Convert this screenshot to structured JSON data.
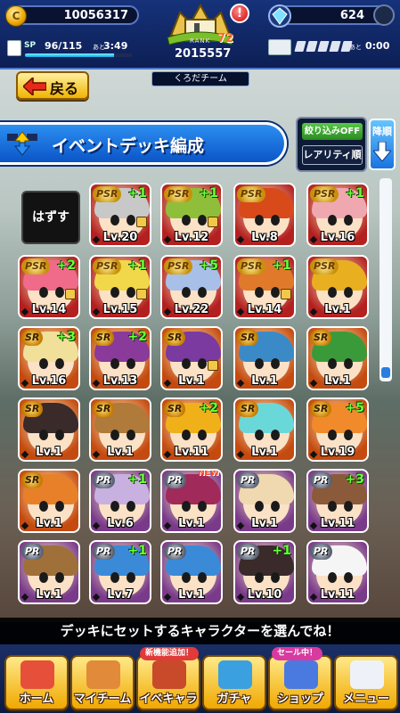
{
  "status": {
    "coins": "10056317",
    "gems": "624",
    "rank_label": "RANK",
    "rank": "72",
    "rank_score": "2015557",
    "team_name": "くろだチーム",
    "sp_label": "SP",
    "sp_value": "96/115",
    "sp_remaining_label": "あと",
    "sp_timer": "3:49",
    "sp_fraction": 0.835,
    "ticket_remaining_label": "あと",
    "ticket_timer": "0:00",
    "alert": "!"
  },
  "header": {
    "back_label": "戻る",
    "title": "イベントデッキ編成",
    "filter_label": "絞り込みOFF",
    "rarity_sort_label": "レアリティ順",
    "sort_order_label": "降順"
  },
  "grid": {
    "remove_label": "はずす",
    "cards": [
      {
        "rarity": "PSR",
        "plus": "+1",
        "level": "Lv.20",
        "locked": true,
        "hair": "#c8c8c8",
        "bg": "#b32020"
      },
      {
        "rarity": "PSR",
        "plus": "+1",
        "level": "Lv.12",
        "locked": true,
        "hair": "#8fbf3a",
        "bg": "#b32020"
      },
      {
        "rarity": "PSR",
        "plus": "",
        "level": "Lv.8",
        "locked": false,
        "hair": "#d84a1a",
        "bg": "#b32020"
      },
      {
        "rarity": "PSR",
        "plus": "+1",
        "level": "Lv.16",
        "locked": false,
        "hair": "#f0a8b0",
        "bg": "#b32020"
      },
      {
        "rarity": "PSR",
        "plus": "+2",
        "level": "Lv.14",
        "locked": true,
        "hair": "#f06a8a",
        "bg": "#b32020"
      },
      {
        "rarity": "PSR",
        "plus": "+1",
        "level": "Lv.15",
        "locked": true,
        "hair": "#f0d84a",
        "bg": "#b32020"
      },
      {
        "rarity": "PSR",
        "plus": "+5",
        "level": "Lv.22",
        "locked": false,
        "hair": "#a8c0e8",
        "bg": "#b32020"
      },
      {
        "rarity": "PSR",
        "plus": "+1",
        "level": "Lv.14",
        "locked": true,
        "hair": "#e07a2a",
        "bg": "#b32020"
      },
      {
        "rarity": "PSR",
        "plus": "",
        "level": "Lv.1",
        "locked": false,
        "hair": "#e8b020",
        "bg": "#b32020"
      },
      {
        "rarity": "SR",
        "plus": "+3",
        "level": "Lv.16",
        "locked": false,
        "hair": "#f0e09a",
        "bg": "#c44a10"
      },
      {
        "rarity": "SR",
        "plus": "+2",
        "level": "Lv.13",
        "locked": false,
        "hair": "#8a3a9a",
        "bg": "#c44a10"
      },
      {
        "rarity": "SR",
        "plus": "",
        "level": "Lv.1",
        "locked": true,
        "hair": "#7a3aa0",
        "bg": "#c44a10"
      },
      {
        "rarity": "SR",
        "plus": "",
        "level": "Lv.1",
        "locked": false,
        "hair": "#3a8ac8",
        "bg": "#c44a10"
      },
      {
        "rarity": "SR",
        "plus": "",
        "level": "Lv.1",
        "locked": false,
        "hair": "#3a9a3a",
        "bg": "#c44a10"
      },
      {
        "rarity": "SR",
        "plus": "",
        "level": "Lv.1",
        "locked": false,
        "hair": "#3a2a2a",
        "bg": "#c44a10"
      },
      {
        "rarity": "SR",
        "plus": "",
        "level": "Lv.1",
        "locked": false,
        "hair": "#b07a3a",
        "bg": "#c44a10"
      },
      {
        "rarity": "SR",
        "plus": "+2",
        "level": "Lv.11",
        "locked": false,
        "hair": "#f0b01a",
        "bg": "#c44a10"
      },
      {
        "rarity": "SR",
        "plus": "",
        "level": "Lv.1",
        "locked": false,
        "hair": "#6ad8d8",
        "bg": "#c44a10"
      },
      {
        "rarity": "SR",
        "plus": "+5",
        "level": "Lv.19",
        "locked": false,
        "hair": "#f08a2a",
        "bg": "#c44a10"
      },
      {
        "rarity": "SR",
        "plus": "",
        "level": "Lv.1",
        "locked": false,
        "hair": "#e8802a",
        "bg": "#c44a10"
      },
      {
        "rarity": "PR",
        "plus": "+1",
        "level": "Lv.6",
        "locked": false,
        "hair": "#c8b0e0",
        "bg": "#7a3a8a"
      },
      {
        "rarity": "PR",
        "plus": "",
        "level": "Lv.1",
        "locked": false,
        "hair": "#a02a5a",
        "bg": "#7a3a8a",
        "new": "NEW"
      },
      {
        "rarity": "PR",
        "plus": "",
        "level": "Lv.1",
        "locked": false,
        "hair": "#f0d8b0",
        "bg": "#7a3a8a"
      },
      {
        "rarity": "PR",
        "plus": "+3",
        "level": "Lv.11",
        "locked": false,
        "hair": "#8a5a3a",
        "bg": "#7a3a8a"
      },
      {
        "rarity": "PR",
        "plus": "",
        "level": "Lv.1",
        "locked": false,
        "hair": "#a0703a",
        "bg": "#7a3a8a"
      },
      {
        "rarity": "PR",
        "plus": "+1",
        "level": "Lv.7",
        "locked": false,
        "hair": "#3a8ad8",
        "bg": "#7a3a8a"
      },
      {
        "rarity": "PR",
        "plus": "",
        "level": "Lv.1",
        "locked": false,
        "hair": "#3a8ad8",
        "bg": "#7a3a8a"
      },
      {
        "rarity": "PR",
        "plus": "+1",
        "level": "Lv.10",
        "locked": false,
        "hair": "#3a2a2a",
        "bg": "#7a3a8a"
      },
      {
        "rarity": "PR",
        "plus": "",
        "level": "Lv.11",
        "locked": false,
        "hair": "#f5f5f5",
        "bg": "#7a3a8a"
      }
    ]
  },
  "message": "デッキにセットするキャラクターを選んでね！",
  "nav": [
    {
      "label": "ホーム",
      "badge": "",
      "icon_color": "#e6503a"
    },
    {
      "label": "マイチーム",
      "badge": "",
      "icon_color": "#e08a3a"
    },
    {
      "label": "イベキャラ",
      "badge": "新機能追加！",
      "icon_color": "#c84a2a"
    },
    {
      "label": "ガチャ",
      "badge": "",
      "icon_color": "#3aa0e0"
    },
    {
      "label": "ショップ",
      "badge": "セール中！",
      "icon_color": "#4a7ae0"
    },
    {
      "label": "メニュー",
      "badge": "",
      "icon_color": "#eef2f8"
    }
  ]
}
